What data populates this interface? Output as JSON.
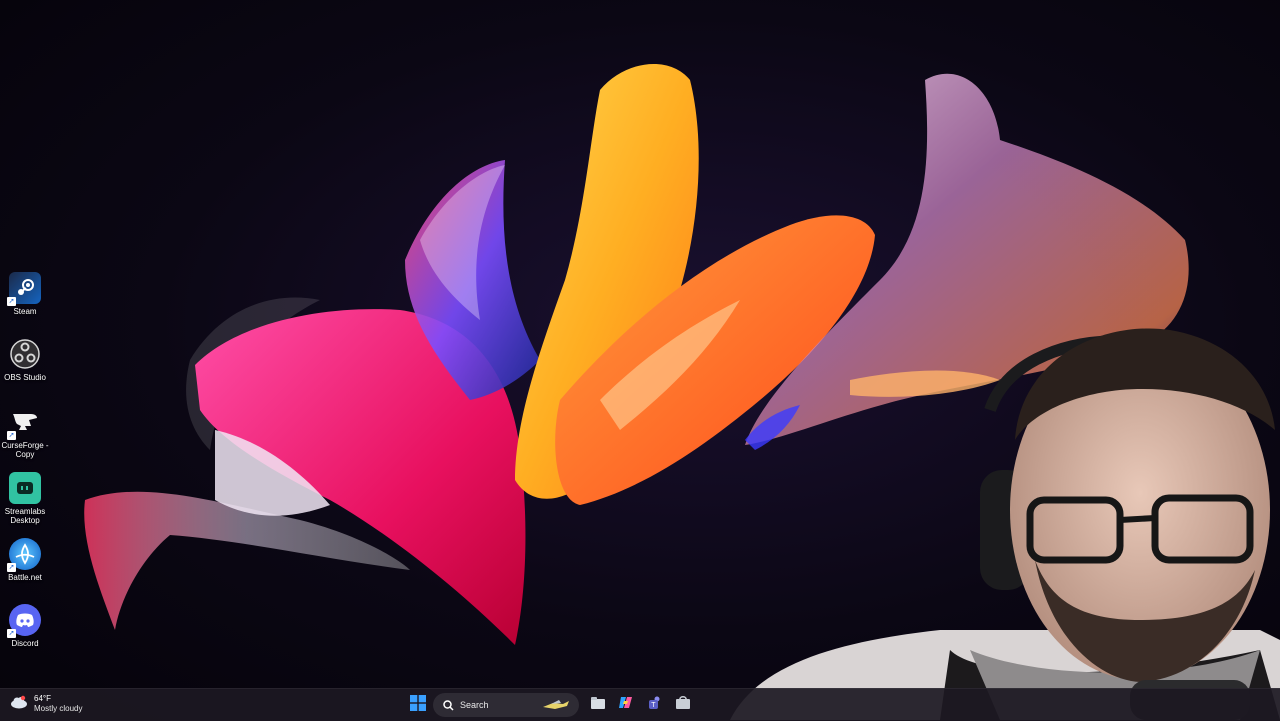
{
  "desktop": {
    "icons": [
      {
        "label": "Steam",
        "icon": "steam-icon"
      },
      {
        "label": "OBS Studio",
        "icon": "obs-icon"
      },
      {
        "label": "CurseForge - Copy",
        "icon": "curseforge-icon"
      },
      {
        "label": "Streamlabs Desktop",
        "icon": "streamlabs-icon"
      },
      {
        "label": "Battle.net",
        "icon": "battlenet-icon"
      },
      {
        "label": "Discord",
        "icon": "discord-icon"
      }
    ]
  },
  "taskbar": {
    "weather": {
      "temperature": "64°F",
      "condition": "Mostly cloudy",
      "icon": "cloud-icon"
    },
    "search": {
      "label": "Search",
      "icon": "search-icon"
    },
    "pinned": [
      "start-icon",
      "file-explorer-icon",
      "copilot-icon",
      "teams-icon",
      "store-icon"
    ]
  },
  "colors": {
    "taskbar_bg": "#1c1822",
    "accent": "#1a8cff"
  }
}
